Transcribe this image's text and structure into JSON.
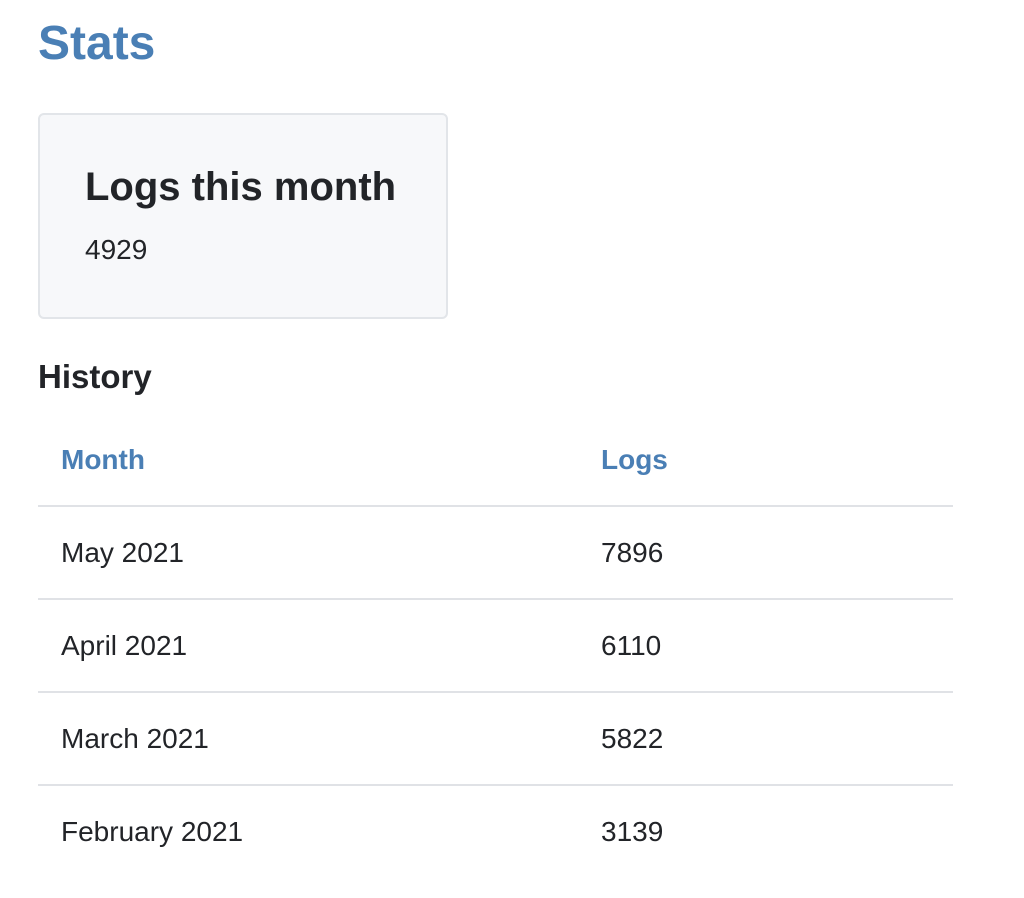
{
  "page": {
    "title": "Stats"
  },
  "card": {
    "title": "Logs this month",
    "value": "4929"
  },
  "history": {
    "title": "History",
    "columns": [
      "Month",
      "Logs"
    ],
    "rows": [
      [
        "May 2021",
        "7896"
      ],
      [
        "April 2021",
        "6110"
      ],
      [
        "March 2021",
        "5822"
      ],
      [
        "February 2021",
        "3139"
      ]
    ]
  },
  "colors": {
    "accent": "#4a7fb5",
    "text": "#222428",
    "card_bg": "#f7f8fa",
    "border": "#e0e2e6"
  }
}
